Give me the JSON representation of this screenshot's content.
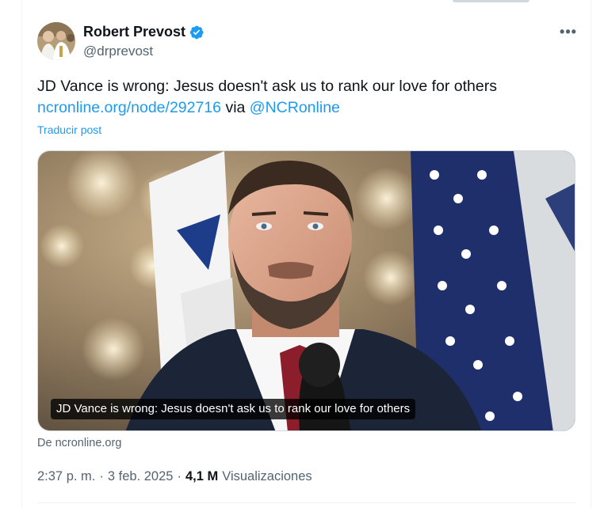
{
  "author": {
    "display_name": "Robert Prevost",
    "handle": "@drprevost",
    "verified": true,
    "avatar_icon": "profile-photo"
  },
  "actions": {
    "more_icon": "more-horizontal-icon",
    "more_label": "•••"
  },
  "post": {
    "text": "JD Vance is wrong: Jesus doesn't ask us to rank our love for others",
    "link_text": "ncronline.org/node/292716",
    "via_text": " via ",
    "mention": "@NCRonline",
    "translate_label": "Traducir post"
  },
  "card": {
    "caption": "JD Vance is wrong: Jesus doesn't ask us to rank our love for others",
    "source": "De ncronline.org"
  },
  "meta": {
    "time": "2:37 p. m.",
    "separator_1": "·",
    "date": "3 feb. 2025",
    "separator_2": "·",
    "views_count": "4,1 M",
    "views_label": "Visualizaciones"
  },
  "colors": {
    "text": "#0f1419",
    "secondary": "#536471",
    "link": "#1d9bf0",
    "divider": "#eff3f4"
  }
}
